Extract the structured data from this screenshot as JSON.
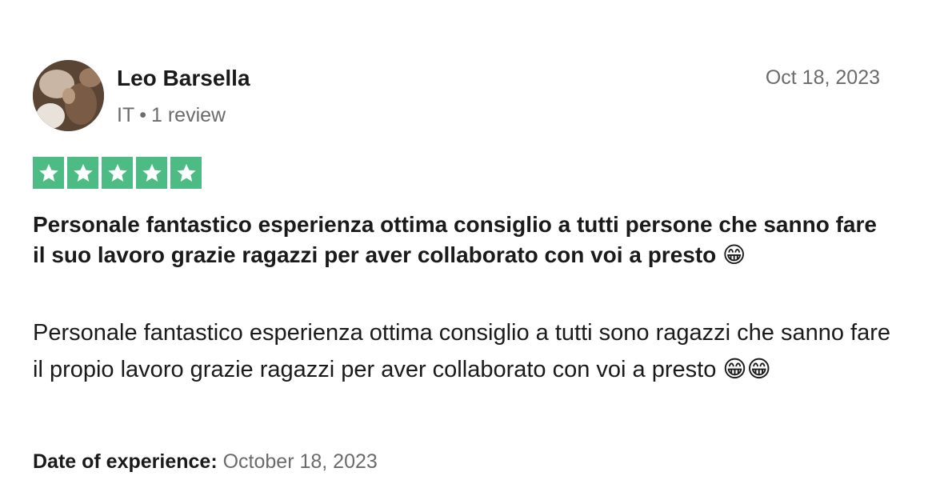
{
  "reviewer": {
    "name": "Leo Barsella",
    "country": "IT",
    "separator": "•",
    "review_count": "1 review"
  },
  "review": {
    "date": "Oct 18, 2023",
    "rating": 5,
    "rating_max": 5,
    "star_color": "#4cbc84",
    "title": "Personale fantastico esperienza ottima consiglio a tutti persone che sanno fare il suo lavoro grazie ragazzi per aver collaborato con voi a presto 😁",
    "body": "Personale fantastico esperienza ottima consiglio a tutti sono ragazzi che sanno fare il propio lavoro grazie ragazzi per aver collaborato con voi a presto 😁😁",
    "experience_label": "Date of experience:",
    "experience_date": "October 18, 2023"
  },
  "icons": {
    "avatar": "avatar-photo",
    "star": "star-icon"
  }
}
